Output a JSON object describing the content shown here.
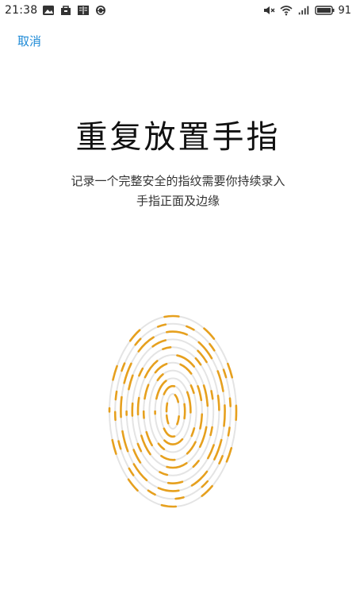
{
  "status_bar": {
    "time": "21:38",
    "battery_level": "91",
    "icons_left": [
      "image-notification-icon",
      "store-icon",
      "reader-icon",
      "sync-icon"
    ],
    "icons_right": [
      "mute-icon",
      "wifi-icon",
      "cellular-signal-icon",
      "battery-icon"
    ]
  },
  "header": {
    "cancel_label": "取消"
  },
  "main": {
    "title": "重复放置手指",
    "subtitle_line1": "记录一个完整安全的指纹需要你持续录入",
    "subtitle_line2": "手指正面及边缘"
  },
  "fingerprint": {
    "icon": "fingerprint-icon",
    "progress_color": "#e6a01e",
    "base_color": "#e4e4e4"
  },
  "colors": {
    "accent": "#1e8ad6",
    "background": "#ffffff",
    "text": "#111111"
  }
}
